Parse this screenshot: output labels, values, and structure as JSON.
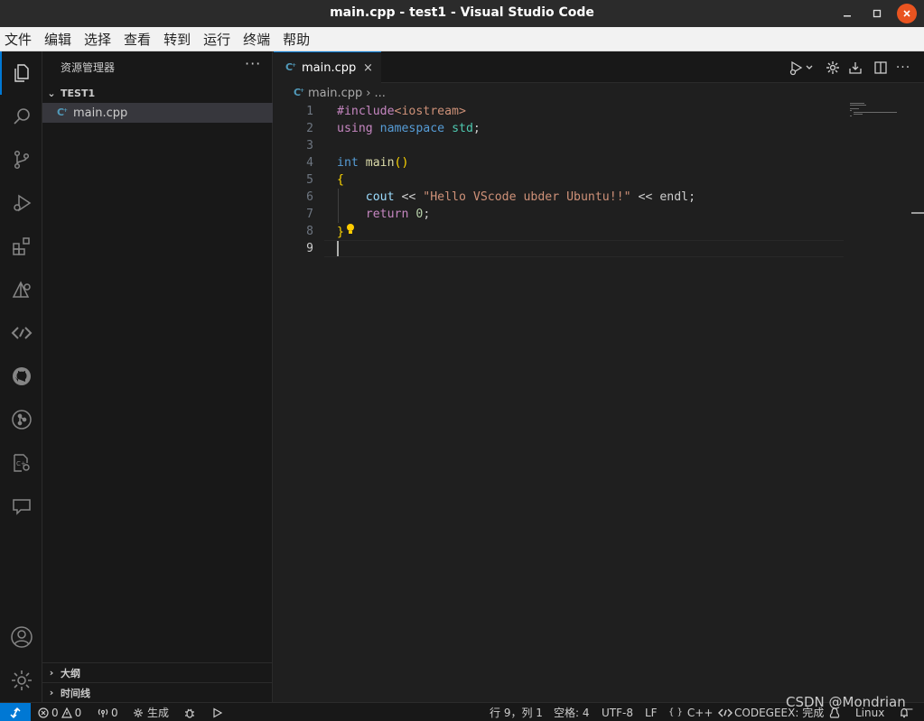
{
  "window": {
    "title": "main.cpp - test1 - Visual Studio Code",
    "controls": {
      "minimize": "‒",
      "maximize": "□",
      "close": "×"
    }
  },
  "menu": [
    "文件",
    "编辑",
    "选择",
    "查看",
    "转到",
    "运行",
    "终端",
    "帮助"
  ],
  "activity_bar": {
    "items": [
      "explorer-icon",
      "search-icon",
      "source-control-icon",
      "run-debug-icon",
      "extensions-icon",
      "remote-explorer-icon",
      "codegeex-icon",
      "github-icon",
      "git-graph-icon",
      "cmake-icon",
      "chat-icon"
    ],
    "bottom": [
      "account-icon",
      "manage-gear-icon"
    ],
    "active": "explorer-icon"
  },
  "sidebar": {
    "title": "资源管理器",
    "more": "···",
    "folder": "TEST1",
    "files": [
      {
        "name": "main.cpp",
        "icon": "C"
      }
    ],
    "sections": [
      "大纲",
      "时间线"
    ]
  },
  "tabs": [
    {
      "label": "main.cpp",
      "icon": "C",
      "close": "×"
    }
  ],
  "breadcrumb": {
    "file": "main.cpp",
    "sep": "›",
    "rest": "..."
  },
  "editor": {
    "line_numbers": [
      "1",
      "2",
      "3",
      "4",
      "5",
      "6",
      "7",
      "8",
      "9"
    ],
    "lines": {
      "l1": {
        "pp": "#include",
        "hdr": "<iostream>"
      },
      "l2": {
        "kw": "using",
        "kw2": "namespace",
        "ns": "std",
        "semi": ";"
      },
      "l4": {
        "kw": "int",
        "fn": "main",
        "paren": "()"
      },
      "l5": {
        "brace": "{"
      },
      "l6": {
        "indent": "    ",
        "var": "cout",
        "op1": " << ",
        "str": "\"Hello VScode ubder Ubuntu!!\"",
        "op2": " << ",
        "var2": "endl",
        "semi": ";"
      },
      "l7": {
        "indent": "    ",
        "ctl": "return",
        "sp": " ",
        "num": "0",
        "semi": ";"
      },
      "l8": {
        "brace": "}"
      }
    },
    "current_line": "9"
  },
  "status_bar": {
    "errors": "0",
    "warnings": "0",
    "ports": "0",
    "build": "生成",
    "position": "行 9，列 1",
    "spaces": "空格: 4",
    "encoding": "UTF-8",
    "eol": "LF",
    "language_icon": "{ }",
    "language": "C++",
    "codegeex": "CODEGEEX: 完成",
    "platform": "Linux"
  },
  "watermark": "CSDN @Mondrian_"
}
